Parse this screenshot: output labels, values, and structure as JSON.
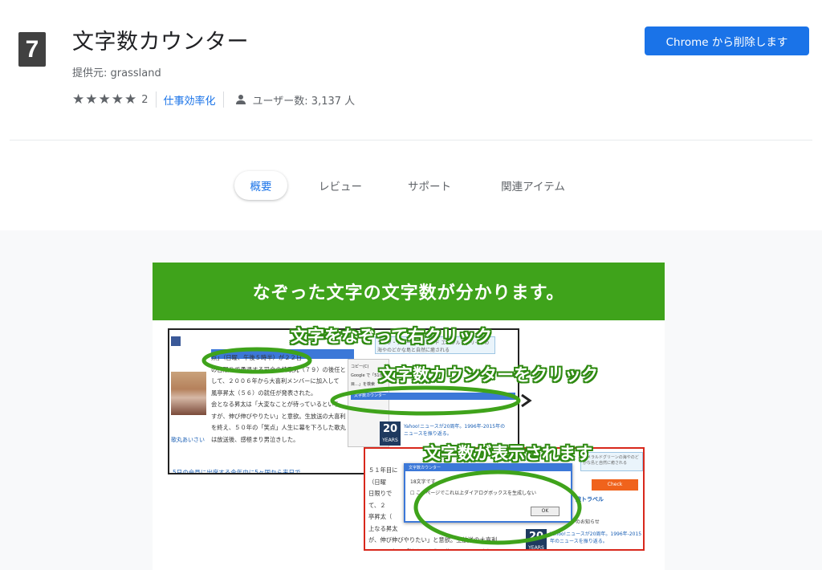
{
  "header": {
    "icon_glyph": "7",
    "title": "文字数カウンター",
    "provider": "提供元: grassland",
    "rating_count": "2",
    "category": "仕事効率化",
    "users": "ユーザー数: 3,137 人",
    "remove_button": "Chrome から削除します",
    "icons": [
      "star-icon",
      "user-icon"
    ],
    "stars_filled": 5
  },
  "tabs": [
    {
      "label": "概要",
      "active": true
    },
    {
      "label": "レビュー"
    },
    {
      "label": "サポート"
    },
    {
      "label": "関連アイテム"
    }
  ],
  "screenshot": {
    "banner": "なぞった文字の文字数が分かります。",
    "callout_1": "文字をなぞって右クリック",
    "callout_2": "文字数カウンターをクリック",
    "callout_3": "文字数が表示されます",
    "selected_text": "５１年目に突入した日本テレビ系演芸番組「笑",
    "article_text": "点」（日曜、午後５時半）が２２日\nの日限りで勇退する司会の桂歌丸（７９）の後任と\nして、２００６年から大喜利メンバーに加入して\n風亭昇太（５６）の就任が発表された。\n会となる昇太は「大変なことが待っているという\nすが、伸び伸びやりたい」と意欲。生放送の大喜利\nを終え、５０年の「笑点」人生に幕を下ろした歌丸\nは放送後、感極まり男泣きした。",
    "photo_caption": "歌丸あいさい",
    "footer_link": "5日の会見に出席する今年中に5ヶ国から来日で",
    "context_menu_items": "コピー(C)\nGoogle で「51年目…」を検索\n印刷(P)...",
    "context_menu_highlight": "文字数カウンター",
    "side_banner_1": "ライフ・ディーダ右部リード\nエメラルドグリーンの海やのどかな島と自然に癒される",
    "yahoo_badge_num": "20",
    "yahoo_badge_label": "YEARS",
    "yahoo_text": "Yahoo!ニュースが20周年。1996年-2015年のニュースを振り返る。",
    "win2_text": "５１年目に\n（日曜\n日限りで\nて、２\n亭昇太（\n上なる昇太\nが、伸び伸びやりたい」と意欲。生放送の大喜利\nえ、５０年の「笑点」人生に幕を下ろした歌丸",
    "dialog_title": "文字数カウンター",
    "dialog_message": "18文字です。",
    "dialog_checkbox": "このページでこれ以上ダイアログボックスを生成しない",
    "dialog_ok": "OK",
    "side_banner_2": "エメラルドグリーンの海やのどかな島と自然に癒される",
    "check_button": "Check",
    "travel_label": "旅トラベル",
    "notice_label": "のお知らせ",
    "colors": {
      "accent_blue": "#1a73e8",
      "banner_green": "#3fa31b",
      "callout_outline": "#2f8a12",
      "win2_border": "#d8281c"
    }
  }
}
